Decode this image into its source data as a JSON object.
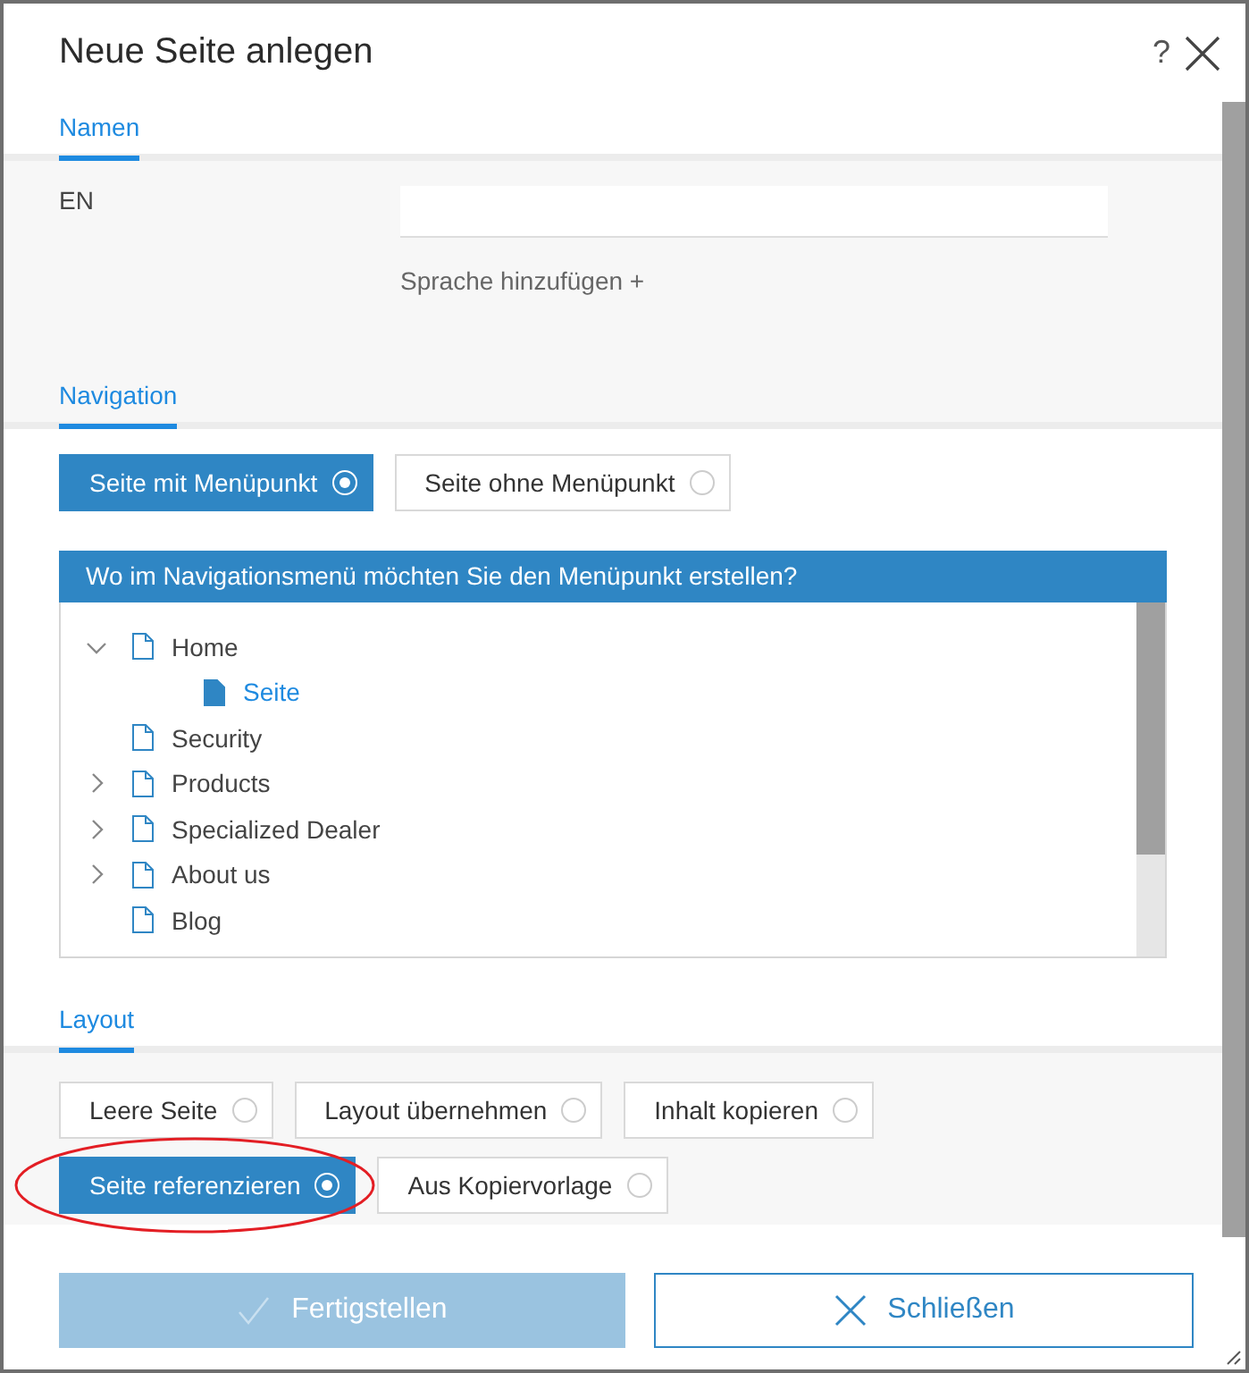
{
  "dialog": {
    "title": "Neue Seite anlegen",
    "help": "?"
  },
  "names_section": {
    "tab": "Namen",
    "language": "EN",
    "add_language": "Sprache hinzufügen +"
  },
  "navigation_section": {
    "tab": "Navigation",
    "options": [
      {
        "label": "Seite mit Menüpunkt",
        "selected": true
      },
      {
        "label": "Seite ohne Menüpunkt",
        "selected": false
      }
    ],
    "tree_title": "Wo im Navigationsmenü möchten Sie den Menüpunkt erstellen?",
    "tree": [
      {
        "label": "Home",
        "expanded": true,
        "selected": false,
        "children": [
          {
            "label": "Seite",
            "selected": true
          }
        ]
      },
      {
        "label": "Security",
        "selected": false
      },
      {
        "label": "Products",
        "expanded": false,
        "selected": false
      },
      {
        "label": "Specialized Dealer",
        "expanded": false,
        "selected": false
      },
      {
        "label": "About us",
        "expanded": false,
        "selected": false
      },
      {
        "label": "Blog",
        "selected": false
      }
    ]
  },
  "layout_section": {
    "tab": "Layout",
    "options": [
      {
        "label": "Leere Seite",
        "selected": false,
        "highlighted": false
      },
      {
        "label": "Layout übernehmen",
        "selected": false,
        "highlighted": false
      },
      {
        "label": "Inhalt kopieren",
        "selected": false,
        "highlighted": false
      },
      {
        "label": "Seite referenzieren",
        "selected": true,
        "highlighted": true
      },
      {
        "label": "Aus Kopiervorlage",
        "selected": false,
        "highlighted": false
      }
    ]
  },
  "footer": {
    "buttons": [
      {
        "label": "Fertigstellen",
        "kind": "confirm",
        "disabled": true
      },
      {
        "label": "Schließen",
        "kind": "close",
        "disabled": false
      }
    ]
  }
}
